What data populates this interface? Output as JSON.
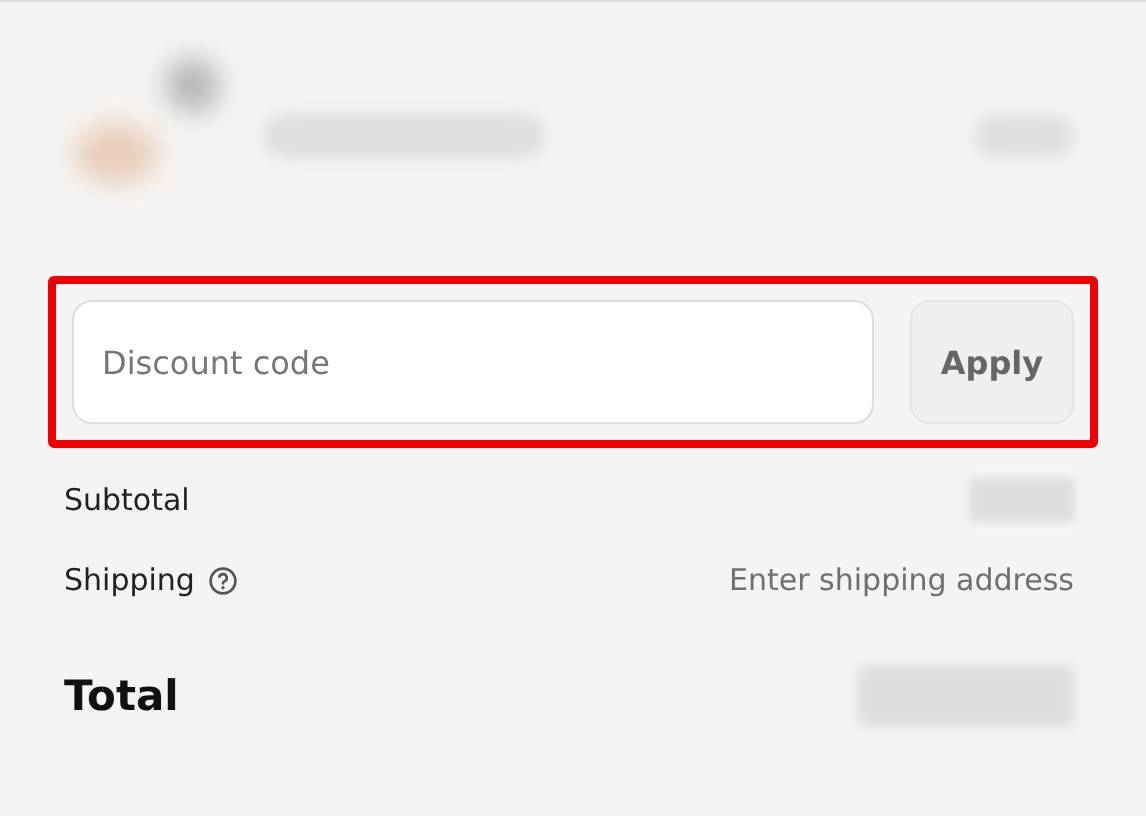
{
  "line_item": {
    "blurred": true
  },
  "discount": {
    "placeholder": "Discount code",
    "button": "Apply",
    "highlighted": true
  },
  "summary": [
    {
      "kind": "value",
      "label": "Subtotal",
      "value_blurred": true
    },
    {
      "kind": "shipping",
      "label": "Shipping",
      "value": "Enter shipping address"
    }
  ],
  "total": {
    "label": "Total",
    "value_blurred": true
  }
}
